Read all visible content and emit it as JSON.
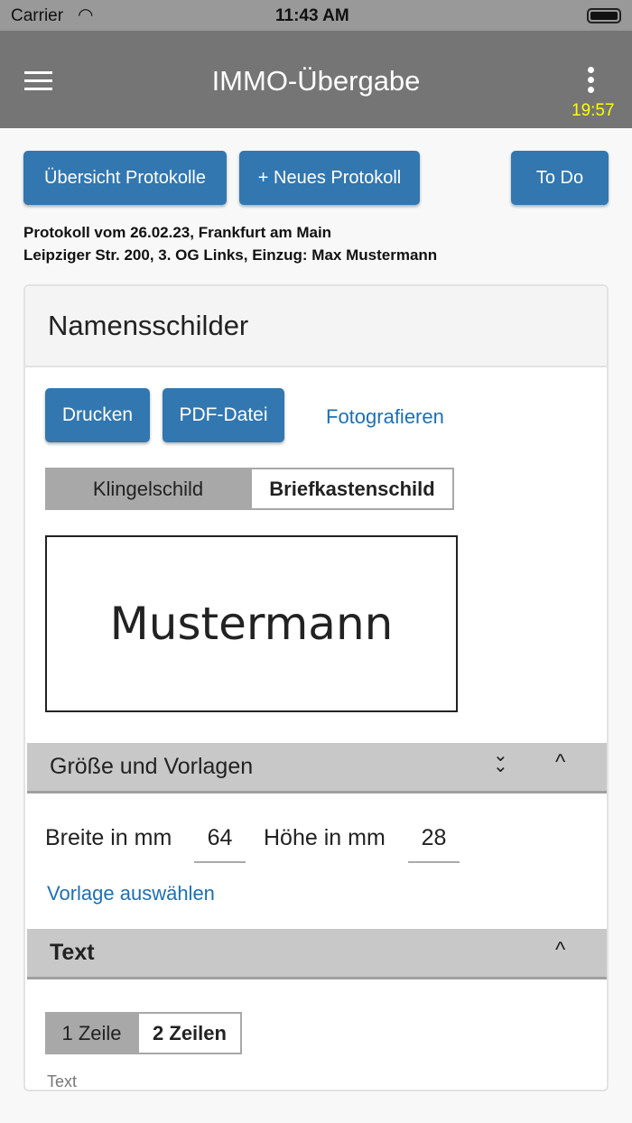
{
  "status_bar": {
    "carrier": "Carrier",
    "time": "11:43 AM"
  },
  "app_bar": {
    "title": "IMMO-Übergabe",
    "timer": "19:57",
    "timer_color": "#ffff00"
  },
  "toolbar": {
    "overview": "Übersicht Protokolle",
    "new": "+ Neues Protokoll",
    "todo": "To Do"
  },
  "protocol": {
    "line1": "Protokoll vom 26.02.23, Frankfurt am Main",
    "line2": "Leipziger Str. 200, 3. OG Links, Einzug: Max Mustermann"
  },
  "card": {
    "title": "Namensschilder",
    "actions": {
      "print": "Drucken",
      "pdf": "PDF-Datei",
      "photo": "Fotografieren"
    },
    "tabs": [
      "Klingelschild",
      "Briefkastenschild"
    ],
    "preview_text": "Mustermann",
    "size_section": {
      "title": "Größe und Vorlagen",
      "width_label": "Breite in mm",
      "width": "64",
      "height_label": "Höhe in mm",
      "height": "28",
      "template_link": "Vorlage auswählen"
    },
    "text_section": {
      "title": "Text",
      "lines": [
        "1 Zeile",
        "2 Zeilen"
      ],
      "field_label": "Text"
    }
  }
}
